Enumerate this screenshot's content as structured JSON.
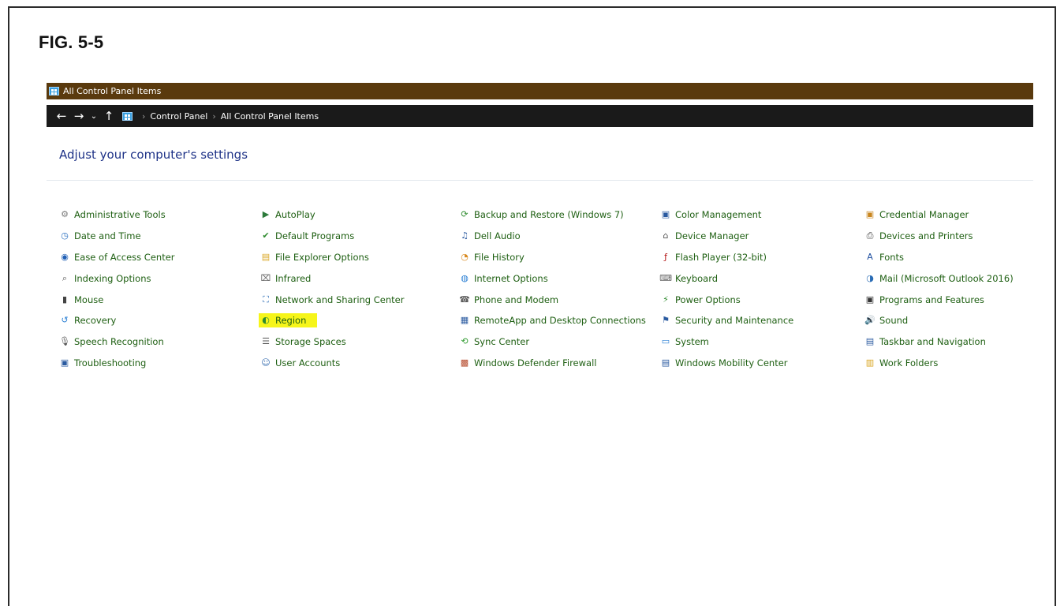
{
  "figure_label": "FIG. 5-5",
  "window": {
    "title": "All Control Panel Items"
  },
  "address": {
    "back": "←",
    "forward": "→",
    "recent": "⌄",
    "up": "↑",
    "sep": "›",
    "crumbs": [
      "Control Panel",
      "All Control Panel Items"
    ]
  },
  "heading": "Adjust your computer's settings",
  "columns": [
    {
      "items": [
        {
          "label": "Administrative Tools",
          "icon": "admin-tools-icon",
          "glyph": "⚙",
          "color": "#7a7a7a"
        },
        {
          "label": "Date and Time",
          "icon": "date-time-icon",
          "glyph": "◷",
          "color": "#2b6fbf"
        },
        {
          "label": "Ease of Access Center",
          "icon": "ease-of-access-icon",
          "glyph": "◉",
          "color": "#1f5fb5"
        },
        {
          "label": "Indexing Options",
          "icon": "indexing-options-icon",
          "glyph": "⌕",
          "color": "#555555"
        },
        {
          "label": "Mouse",
          "icon": "mouse-icon",
          "glyph": "▮",
          "color": "#444444"
        },
        {
          "label": "Recovery",
          "icon": "recovery-icon",
          "glyph": "↺",
          "color": "#2a7fd4"
        },
        {
          "label": "Speech Recognition",
          "icon": "speech-recognition-icon",
          "glyph": "🎙",
          "color": "#555555"
        },
        {
          "label": "Troubleshooting",
          "icon": "troubleshooting-icon",
          "glyph": "▣",
          "color": "#2a5aa0"
        }
      ]
    },
    {
      "items": [
        {
          "label": "AutoPlay",
          "icon": "autoplay-icon",
          "glyph": "▶",
          "color": "#2c7a3a"
        },
        {
          "label": "Default Programs",
          "icon": "default-programs-icon",
          "glyph": "✔",
          "color": "#2e8b2e"
        },
        {
          "label": "File Explorer Options",
          "icon": "file-explorer-options-icon",
          "glyph": "▤",
          "color": "#d9a520"
        },
        {
          "label": "Infrared",
          "icon": "infrared-icon",
          "glyph": "⌧",
          "color": "#666666"
        },
        {
          "label": "Network and Sharing Center",
          "icon": "network-sharing-icon",
          "glyph": "⛶",
          "color": "#2a6cb5"
        },
        {
          "label": "Region",
          "icon": "region-icon",
          "glyph": "◐",
          "color": "#2e8b2e",
          "highlight": true
        },
        {
          "label": "Storage Spaces",
          "icon": "storage-spaces-icon",
          "glyph": "☰",
          "color": "#555555"
        },
        {
          "label": "User Accounts",
          "icon": "user-accounts-icon",
          "glyph": "☺",
          "color": "#3a6fb0"
        }
      ]
    },
    {
      "items": [
        {
          "label": "Backup and Restore (Windows 7)",
          "icon": "backup-restore-icon",
          "glyph": "⟳",
          "color": "#2e8b2e"
        },
        {
          "label": "Dell Audio",
          "icon": "dell-audio-icon",
          "glyph": "♫",
          "color": "#2a5aa0"
        },
        {
          "label": "File History",
          "icon": "file-history-icon",
          "glyph": "◔",
          "color": "#d98a20"
        },
        {
          "label": "Internet Options",
          "icon": "internet-options-icon",
          "glyph": "◍",
          "color": "#2a7fd4"
        },
        {
          "label": "Phone and Modem",
          "icon": "phone-modem-icon",
          "glyph": "☎",
          "color": "#5a5a5a"
        },
        {
          "label": "RemoteApp and Desktop Connections",
          "icon": "remoteapp-icon",
          "glyph": "▦",
          "color": "#2a5aa0"
        },
        {
          "label": "Sync Center",
          "icon": "sync-center-icon",
          "glyph": "⟲",
          "color": "#2e9a2e"
        },
        {
          "label": "Windows Defender Firewall",
          "icon": "firewall-icon",
          "glyph": "▩",
          "color": "#b5482a"
        }
      ]
    },
    {
      "items": [
        {
          "label": "Color Management",
          "icon": "color-management-icon",
          "glyph": "▣",
          "color": "#2a5aa0"
        },
        {
          "label": "Device Manager",
          "icon": "device-manager-icon",
          "glyph": "⌂",
          "color": "#555555"
        },
        {
          "label": "Flash Player (32-bit)",
          "icon": "flash-player-icon",
          "glyph": "ƒ",
          "color": "#b31212"
        },
        {
          "label": "Keyboard",
          "icon": "keyboard-icon",
          "glyph": "⌨",
          "color": "#666666"
        },
        {
          "label": "Power Options",
          "icon": "power-options-icon",
          "glyph": "⚡",
          "color": "#2e8b2e"
        },
        {
          "label": "Security and Maintenance",
          "icon": "security-maintenance-icon",
          "glyph": "⚑",
          "color": "#2a5aa0"
        },
        {
          "label": "System",
          "icon": "system-icon",
          "glyph": "▭",
          "color": "#2a7fd4"
        },
        {
          "label": "Windows Mobility Center",
          "icon": "mobility-center-icon",
          "glyph": "▤",
          "color": "#2a5aa0"
        }
      ]
    },
    {
      "items": [
        {
          "label": "Credential Manager",
          "icon": "credential-manager-icon",
          "glyph": "▣",
          "color": "#c8851e"
        },
        {
          "label": "Devices and Printers",
          "icon": "devices-printers-icon",
          "glyph": "⎙",
          "color": "#444444"
        },
        {
          "label": "Fonts",
          "icon": "fonts-icon",
          "glyph": "A",
          "color": "#1f4fa0"
        },
        {
          "label": "Mail (Microsoft Outlook 2016)",
          "icon": "mail-icon",
          "glyph": "◑",
          "color": "#2a6cb5"
        },
        {
          "label": "Programs and Features",
          "icon": "programs-features-icon",
          "glyph": "▣",
          "color": "#333333"
        },
        {
          "label": "Sound",
          "icon": "sound-icon",
          "glyph": "🔊",
          "color": "#666666"
        },
        {
          "label": "Taskbar and Navigation",
          "icon": "taskbar-navigation-icon",
          "glyph": "▤",
          "color": "#2a5aa0"
        },
        {
          "label": "Work Folders",
          "icon": "work-folders-icon",
          "glyph": "▥",
          "color": "#d9a520"
        }
      ]
    }
  ]
}
